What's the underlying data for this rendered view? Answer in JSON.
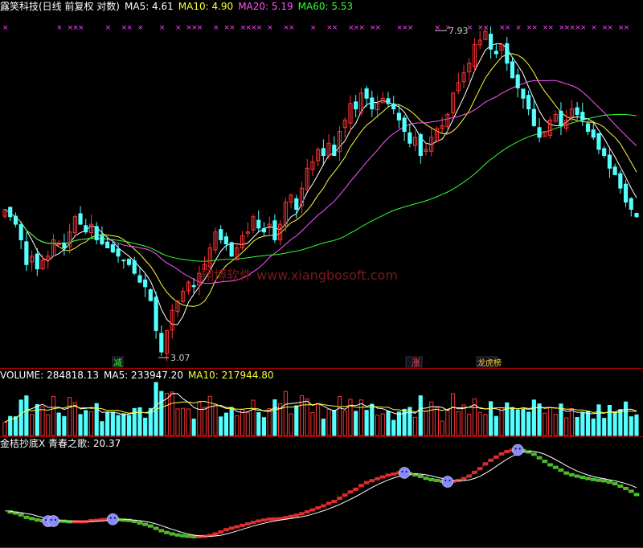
{
  "main": {
    "title": "露笑科技(日线 前复权 对数)",
    "ma5": "MA5: 4.61",
    "ma10": "MA10: 4.90",
    "ma20": "MA20: 5.19",
    "ma60": "MA60: 5.53",
    "high_label": "7.93",
    "low_label": "3.07",
    "watermark": "翔博软件 www.xiangbosoft.com",
    "event_labels": [
      "减",
      "涨",
      "龙虎榜"
    ]
  },
  "volume": {
    "label": "VOLUME: 284818.13",
    "ma5": "MA5: 233947.20",
    "ma10": "MA10: 217944.80"
  },
  "indicator": {
    "label": "金桔抄底X 青春之歌: 20.37"
  },
  "chart_data": [
    {
      "type": "candlestick",
      "title": "露笑科技(日线 前复权 对数)",
      "scale": "log",
      "ylim": [
        3.0,
        8.3
      ],
      "annotations": [
        {
          "label": "7.93",
          "value": 7.93
        },
        {
          "label": "3.07",
          "value": 3.07
        }
      ],
      "series": [
        {
          "name": "MA5",
          "color": "#ffffff",
          "last": 4.61
        },
        {
          "name": "MA10",
          "color": "#ffff33",
          "last": 4.9
        },
        {
          "name": "MA20",
          "color": "#ff55ff",
          "last": 5.19
        },
        {
          "name": "MA60",
          "color": "#33ff33",
          "last": 5.53
        }
      ],
      "closes": [
        4.7,
        4.6,
        4.5,
        4.3,
        4.0,
        4.1,
        3.95,
        4.05,
        4.1,
        4.3,
        4.25,
        4.2,
        4.4,
        4.6,
        4.5,
        4.4,
        4.5,
        4.3,
        4.25,
        4.2,
        4.15,
        4.1,
        4.05,
        4.0,
        3.9,
        3.8,
        3.75,
        3.6,
        3.3,
        3.1,
        3.3,
        3.5,
        3.6,
        3.7,
        3.8,
        3.75,
        3.9,
        4.0,
        4.2,
        4.4,
        4.3,
        4.25,
        4.1,
        4.2,
        4.35,
        4.4,
        4.6,
        4.45,
        4.4,
        4.5,
        4.3,
        4.5,
        4.8,
        4.9,
        4.7,
        5.0,
        5.3,
        5.4,
        5.6,
        5.5,
        5.7,
        5.5,
        5.9,
        6.1,
        6.4,
        6.3,
        6.6,
        6.5,
        6.3,
        6.4,
        6.5,
        6.4,
        6.3,
        6.1,
        5.9,
        5.7,
        5.8,
        5.5,
        5.6,
        5.8,
        5.95,
        6.0,
        6.2,
        6.6,
        6.8,
        7.0,
        7.2,
        7.6,
        7.7,
        7.9,
        7.5,
        7.4,
        7.6,
        7.2,
        6.9,
        6.7,
        6.5,
        6.3,
        6.0,
        5.8,
        5.9,
        6.1,
        6.2,
        6.0,
        6.1,
        6.3,
        6.2,
        6.1,
        5.9,
        5.8,
        5.6,
        5.5,
        5.3,
        5.2,
        5.0,
        4.8,
        4.7,
        4.6
      ]
    },
    {
      "type": "bar",
      "title": "VOLUME",
      "series": [
        {
          "name": "VOLUME",
          "last": 284818.13
        },
        {
          "name": "MA5",
          "color": "#ffffff",
          "last": 233947.2
        },
        {
          "name": "MA10",
          "color": "#ffff33",
          "last": 217944.8
        }
      ]
    },
    {
      "type": "line",
      "title": "金桔抄底X",
      "series": [
        {
          "name": "青春之歌",
          "last": 20.37
        }
      ]
    }
  ]
}
